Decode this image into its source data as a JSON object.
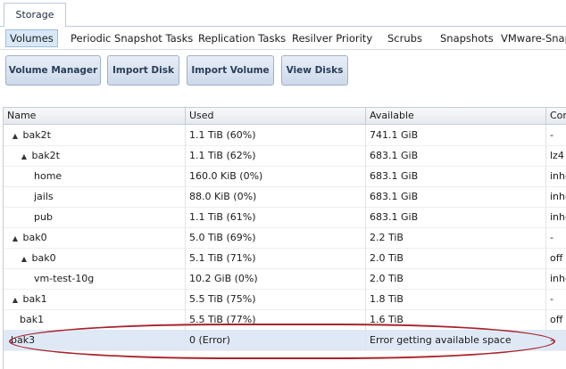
{
  "top_tab": {
    "label": "Storage"
  },
  "subtabs": [
    {
      "label": "Volumes",
      "active": true
    },
    {
      "label": "Periodic Snapshot Tasks"
    },
    {
      "label": "Replication Tasks"
    },
    {
      "label": "Resilver Priority"
    },
    {
      "label": "Scrubs"
    },
    {
      "label": "Snapshots"
    },
    {
      "label": "VMware-Snap"
    }
  ],
  "toolbar": {
    "volume_manager": "Volume Manager",
    "import_disk": "Import Disk",
    "import_volume": "Import Volume",
    "view_disks": "View Disks"
  },
  "table": {
    "columns": [
      "Name",
      "Used",
      "Available",
      "Com"
    ],
    "rows": [
      {
        "name": "bak2t",
        "used": "1.1 TiB (60%)",
        "available": "741.1 GiB",
        "extra": "-",
        "indent": 0,
        "expander": "▲"
      },
      {
        "name": "bak2t",
        "used": "1.1 TiB (62%)",
        "available": "683.1 GiB",
        "extra": "lz4",
        "indent": 1,
        "expander": "▲"
      },
      {
        "name": "home",
        "used": "160.0 KiB (0%)",
        "available": "683.1 GiB",
        "extra": "inhe",
        "indent": 2,
        "expander": ""
      },
      {
        "name": "jails",
        "used": "88.0 KiB (0%)",
        "available": "683.1 GiB",
        "extra": "inhe",
        "indent": 2,
        "expander": ""
      },
      {
        "name": "pub",
        "used": "1.1 TiB (61%)",
        "available": "683.1 GiB",
        "extra": "inhe",
        "indent": 2,
        "expander": ""
      },
      {
        "name": "bak0",
        "used": "5.0 TiB (69%)",
        "available": "2.2 TiB",
        "extra": "-",
        "indent": 0,
        "expander": "▲"
      },
      {
        "name": "bak0",
        "used": "5.1 TiB (71%)",
        "available": "2.0 TiB",
        "extra": "off",
        "indent": 1,
        "expander": "▲"
      },
      {
        "name": "vm-test-10g",
        "used": "10.2 GiB (0%)",
        "available": "2.0 TiB",
        "extra": "inhe",
        "indent": 2,
        "expander": ""
      },
      {
        "name": "bak1",
        "used": "5.5 TiB (75%)",
        "available": "1.8 TiB",
        "extra": "-",
        "indent": 0,
        "expander": "▲"
      },
      {
        "name": "bak1",
        "used": "5.5 TiB (77%)",
        "available": "1.6 TiB",
        "extra": "off",
        "indent": 1,
        "expander": ""
      },
      {
        "name": "bak3",
        "used": "0 (Error)",
        "available": "Error getting available space",
        "extra": "-",
        "indent": 0,
        "expander": "",
        "selected": true
      }
    ]
  },
  "colors": {
    "highlight": "#a8232b",
    "selected_row": "#dfe9f6"
  }
}
